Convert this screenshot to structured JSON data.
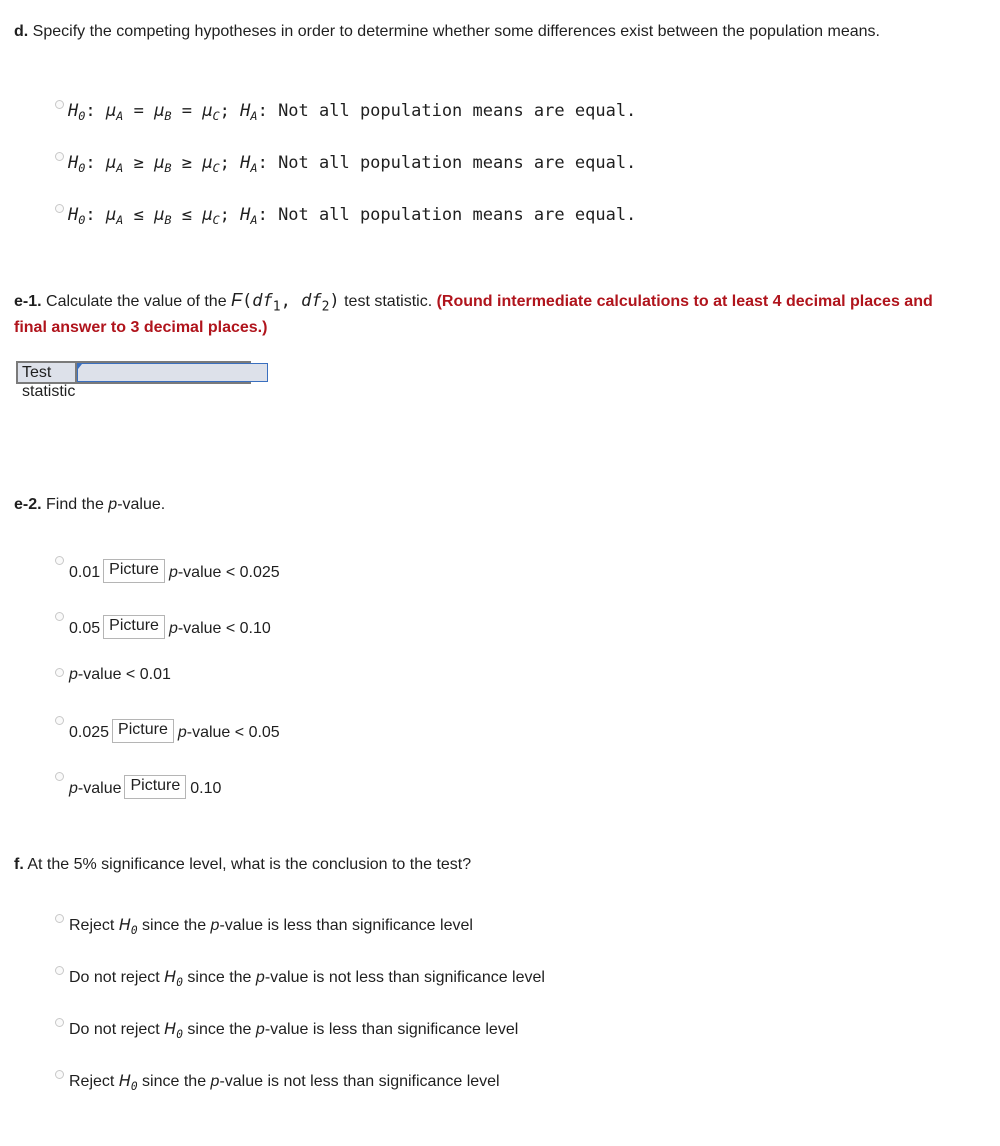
{
  "part_d": {
    "label": "d.",
    "prompt": "Specify the competing hypotheses in order to determine whether some differences exist between the population means.",
    "options": [
      {
        "h0": "H",
        "h0_sub": "0",
        "mu": "μ",
        "a": "A",
        "op1": "=",
        "b": "B",
        "op2": "=",
        "c": "C",
        "sep": ";",
        "ha": "H",
        "ha_sub": "A",
        "tail": ": Not all population means are equal."
      },
      {
        "h0": "H",
        "h0_sub": "0",
        "mu": "μ",
        "a": "A",
        "op1": "≥",
        "b": "B",
        "op2": "≥",
        "c": "C",
        "sep": ";",
        "ha": "H",
        "ha_sub": "A",
        "tail": ": Not all population means are equal."
      },
      {
        "h0": "H",
        "h0_sub": "0",
        "mu": "μ",
        "a": "A",
        "op1": "≤",
        "b": "B",
        "op2": "≤",
        "c": "C",
        "sep": ";",
        "ha": "H",
        "ha_sub": "A",
        "tail": ": Not all population means are equal."
      }
    ]
  },
  "part_e1": {
    "label": "e-1.",
    "prompt_before": "Calculate the value of the",
    "f_symbol": "F",
    "df1": "df",
    "df1_sub": "1",
    "df2": "df",
    "df2_sub": "2",
    "prompt_after": "test statistic.",
    "instruction": "(Round intermediate calculations to at least 4 decimal places and final answer to 3 decimal places.)",
    "table_label": "Test statistic",
    "input_value": ""
  },
  "part_e2": {
    "label": "e-2.",
    "prompt_before": "Find the",
    "p": "p",
    "prompt_after": "-value.",
    "picture_label": "Picture",
    "options": [
      {
        "left": "0.01",
        "p": "p",
        "right": "-value < 0.025"
      },
      {
        "left": "0.05",
        "p": "p",
        "right": "-value < 0.10"
      },
      {
        "p": "p",
        "right": "-value < 0.01"
      },
      {
        "left": "0.025",
        "p": "p",
        "right": "-value < 0.05"
      },
      {
        "p": "p",
        "mid": "-value",
        "right": "0.10"
      }
    ]
  },
  "part_f": {
    "label": "f.",
    "prompt": "At the 5% significance level, what is the conclusion to the test?",
    "options": [
      {
        "pre": "Reject",
        "h": "H",
        "h_sub": "0",
        "mid": "since the",
        "p": "p",
        "post": "-value is less than significance level"
      },
      {
        "pre": "Do not reject",
        "h": "H",
        "h_sub": "0",
        "mid": "since the",
        "p": "p",
        "post": "-value is not less than significance level"
      },
      {
        "pre": "Do not reject",
        "h": "H",
        "h_sub": "0",
        "mid": "since the",
        "p": "p",
        "post": "-value is less than significance level"
      },
      {
        "pre": "Reject",
        "h": "H",
        "h_sub": "0",
        "mid": "since the",
        "p": "p",
        "post": "-value is not less than significance level"
      }
    ]
  }
}
